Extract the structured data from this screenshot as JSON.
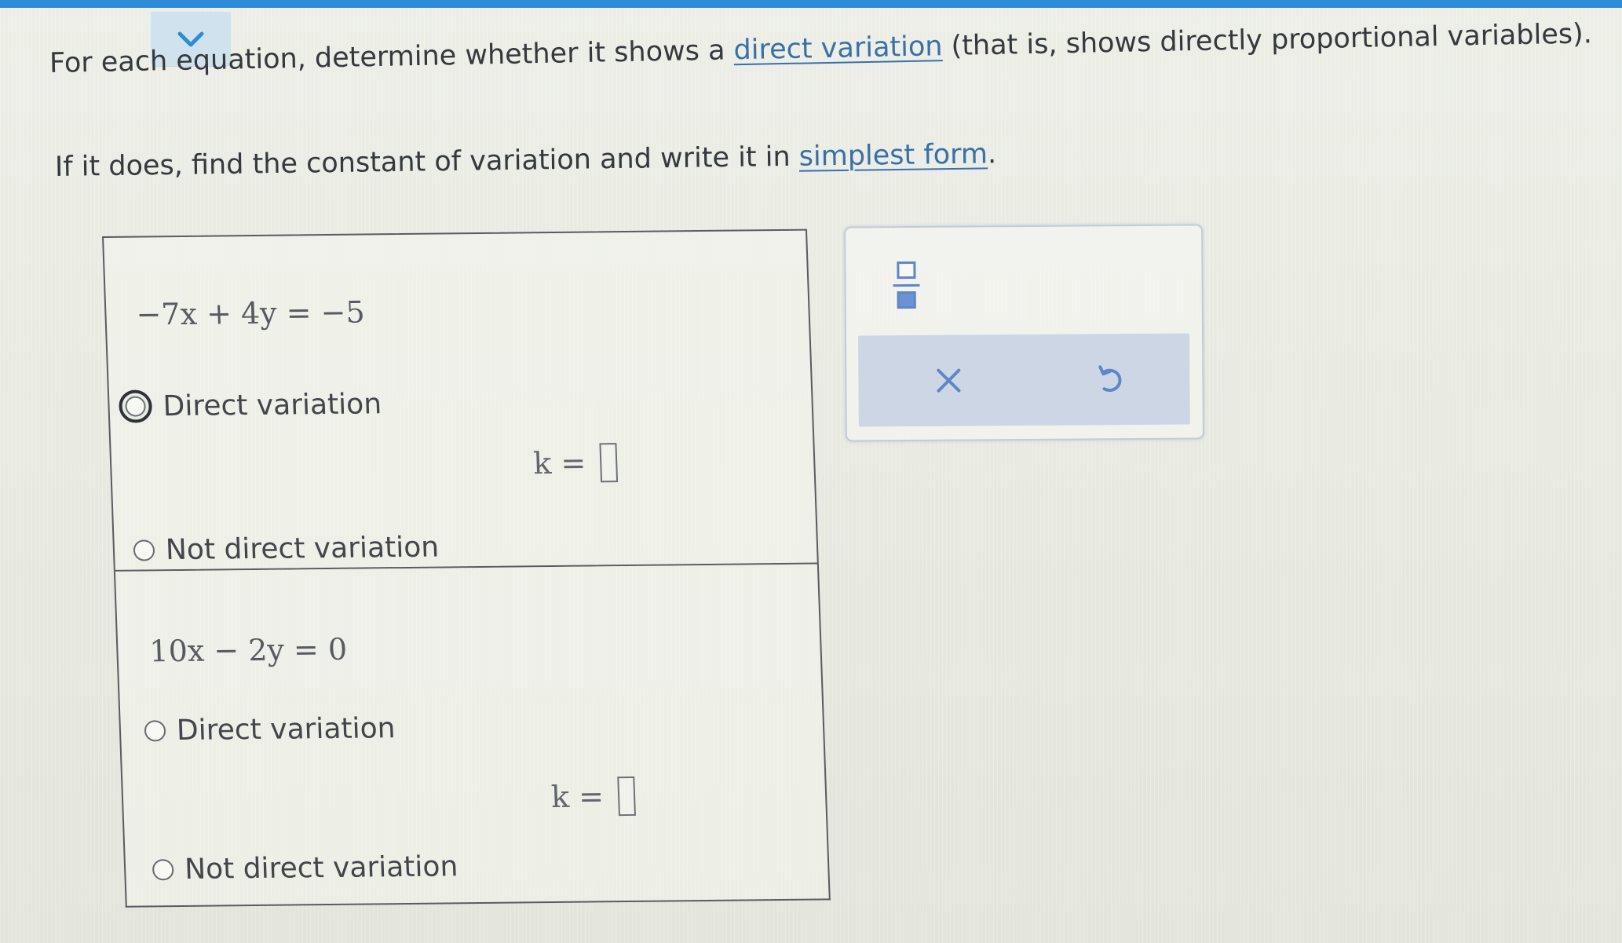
{
  "ui": {
    "collapse_icon": "chevron-down-icon",
    "colors": {
      "top_bar": "#2d8bd7",
      "link": "#3870a8",
      "tool_icon": "#5d87c6",
      "action_bar": "#cdd6e5",
      "text": "#35383d"
    }
  },
  "instructions": {
    "line1_prefix": "For each equation, determine whether it shows a ",
    "line1_link": "direct variation",
    "line1_suffix": " (that is, shows directly proportional variables).",
    "line2_prefix": "If it does, find the constant of variation and write it in ",
    "line2_link": "simplest form",
    "line2_suffix": "."
  },
  "problems": [
    {
      "equation": "−7x + 4y = −5",
      "direct_label": "Direct variation",
      "not_direct_label": "Not direct variation",
      "k_label": "k =",
      "k_value": ""
    },
    {
      "equation": "10x − 2y = 0",
      "direct_label": "Direct variation",
      "not_direct_label": "Not direct variation",
      "k_label": "k =",
      "k_value": ""
    }
  ],
  "tools": {
    "fraction_icon": "fraction-icon",
    "clear_icon": "close-icon",
    "undo_icon": "undo-icon"
  }
}
